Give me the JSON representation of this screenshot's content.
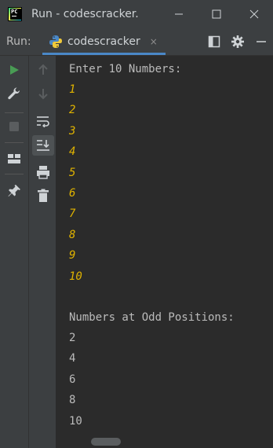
{
  "window": {
    "logo_text": "PC",
    "title": "Run - codescracker."
  },
  "toolbar": {
    "run_label": "Run:",
    "tab_label": "codescracker",
    "tab_close": "×"
  },
  "console": {
    "prompt": "Enter 10 Numbers:",
    "inputs": [
      "1",
      "2",
      "3",
      "4",
      "5",
      "6",
      "7",
      "8",
      "9",
      "10"
    ],
    "result_header": "Numbers at Odd Positions:",
    "outputs": [
      "2",
      "4",
      "6",
      "8",
      "10"
    ]
  },
  "colors": {
    "background": "#2b2b2b",
    "panel": "#3c3f41",
    "input_text": "#e0b300",
    "output_text": "#bbbbbb",
    "run_green": "#499c54",
    "accent_blue": "#4a88c7"
  },
  "icons": {
    "titlebar": [
      "minimize-icon",
      "maximize-icon",
      "close-icon"
    ],
    "toolbar": [
      "layout-icon",
      "gear-icon",
      "hide-icon"
    ],
    "left": [
      "run-icon",
      "wrench-icon",
      "stop-icon",
      "layout-grid-icon",
      "pin-icon"
    ],
    "left2": [
      "up-arrow-icon",
      "down-arrow-icon",
      "soft-wrap-icon",
      "scroll-to-end-icon",
      "print-icon",
      "trash-icon"
    ]
  }
}
